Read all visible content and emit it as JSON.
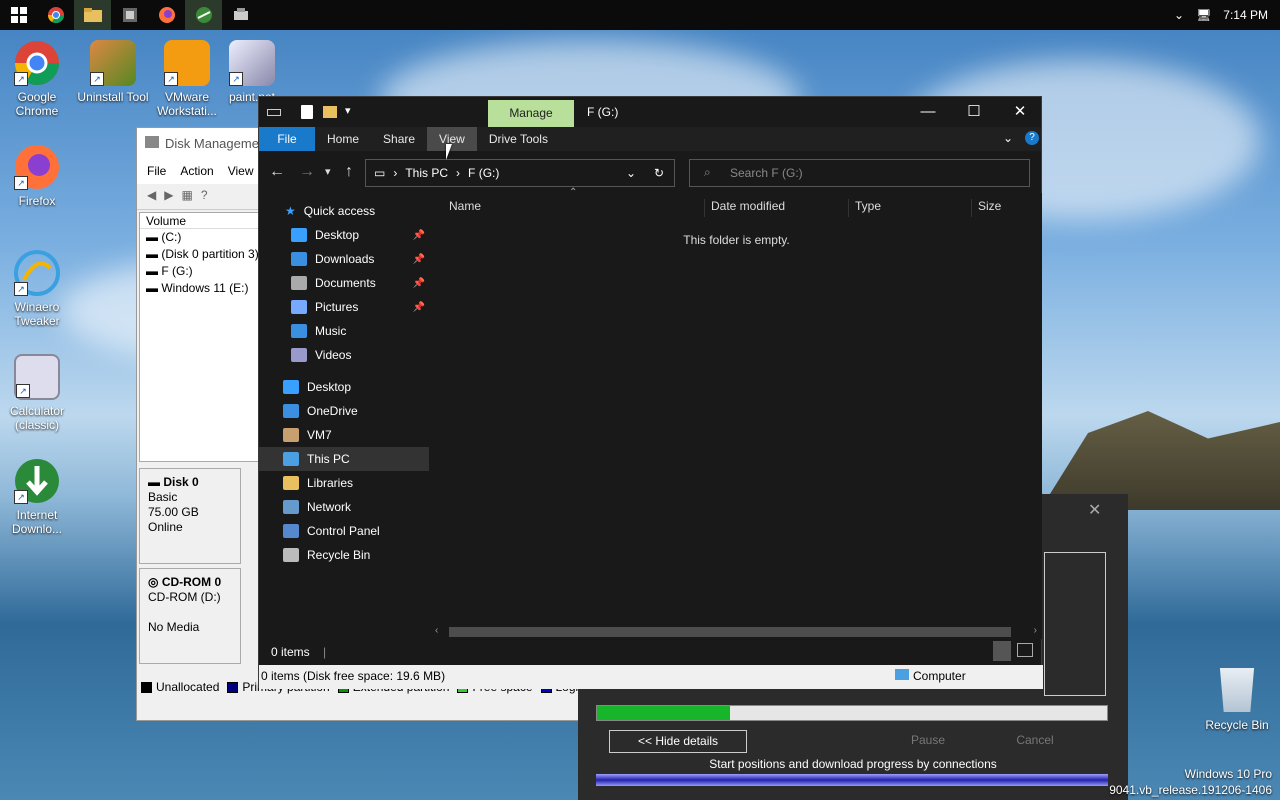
{
  "taskbar": {
    "clock": "7:14 PM",
    "apps": [
      "windows-start",
      "chrome",
      "file-explorer",
      "app-generic",
      "firefox",
      "winaero",
      "app-generic-2"
    ]
  },
  "desktop": {
    "icons": [
      {
        "label": "Google\nChrome",
        "icon": "chrome-icon"
      },
      {
        "label": "Uninstall Tool",
        "icon": "uninstall-tool-icon"
      },
      {
        "label": "VMware\nWorkstati...",
        "icon": "vmware-icon"
      },
      {
        "label": "paint.net",
        "icon": "paint-net-icon"
      },
      {
        "label": "Firefox",
        "icon": "firefox-icon"
      },
      {
        "label": "Winaero\nTweaker",
        "icon": "winaero-icon"
      },
      {
        "label": "Calculator\n(classic)",
        "icon": "calculator-icon"
      },
      {
        "label": "Internet\nDownlo...",
        "icon": "idm-icon"
      }
    ],
    "recycle_bin": "Recycle Bin"
  },
  "watermark": {
    "line1": "Windows 10 Pro",
    "line2": "9041.vb_release.191206-1406"
  },
  "disk_management": {
    "title": "Disk Managemen",
    "menu": [
      "File",
      "Action",
      "View"
    ],
    "column": "Volume",
    "volumes": [
      "(C:)",
      "(Disk 0 partition 3)",
      "F (G:)",
      "Windows 11 (E:)"
    ],
    "disk0": {
      "name": "Disk 0",
      "type": "Basic",
      "size": "75.00 GB",
      "status": "Online"
    },
    "cdrom": {
      "name": "CD-ROM 0",
      "type": "CD-ROM (D:)",
      "status": "No Media"
    },
    "legend": [
      {
        "label": "Unallocated",
        "color": "#000000"
      },
      {
        "label": "Primary partition",
        "color": "#00007f"
      },
      {
        "label": "Extended partition",
        "color": "#009900"
      },
      {
        "label": "Free space",
        "color": "#33cc33"
      },
      {
        "label": "Logic",
        "color": "#0000cc"
      }
    ]
  },
  "download": {
    "progress": 0.26,
    "hide_details": "<< Hide details",
    "pause": "Pause",
    "cancel": "Cancel",
    "caption": "Start positions and download progress by connections"
  },
  "explorer": {
    "title": "F (G:)",
    "manage": "Manage",
    "tabs": [
      "File",
      "Home",
      "Share",
      "View",
      "Drive Tools"
    ],
    "address": [
      "This PC",
      "F (G:)"
    ],
    "search_placeholder": "Search F (G:)",
    "columns": [
      "Name",
      "Date modified",
      "Type",
      "Size"
    ],
    "empty_text": "This folder is empty.",
    "nav": {
      "quick_access": "Quick access",
      "quick": [
        {
          "label": "Desktop",
          "color": "#3aa0ff"
        },
        {
          "label": "Downloads",
          "color": "#3a8fe0"
        },
        {
          "label": "Documents",
          "color": "#aaaaaa"
        },
        {
          "label": "Pictures",
          "color": "#77aaff"
        },
        {
          "label": "Music",
          "color": "#3a8fe0"
        },
        {
          "label": "Videos",
          "color": "#9999cc"
        }
      ],
      "tree": [
        {
          "label": "Desktop",
          "color": "#3aa0ff"
        },
        {
          "label": "OneDrive",
          "color": "#3a8fe0"
        },
        {
          "label": "VM7",
          "color": "#c8a070"
        },
        {
          "label": "This PC",
          "color": "#4aa0e0"
        },
        {
          "label": "Libraries",
          "color": "#e8c060"
        },
        {
          "label": "Network",
          "color": "#6699cc"
        },
        {
          "label": "Control Panel",
          "color": "#5588cc"
        },
        {
          "label": "Recycle Bin",
          "color": "#bbbbbb"
        }
      ]
    },
    "status_items": "0 items",
    "status_free": "0 items (Disk free space: 19.6 MB)",
    "status_computer": "Computer"
  }
}
